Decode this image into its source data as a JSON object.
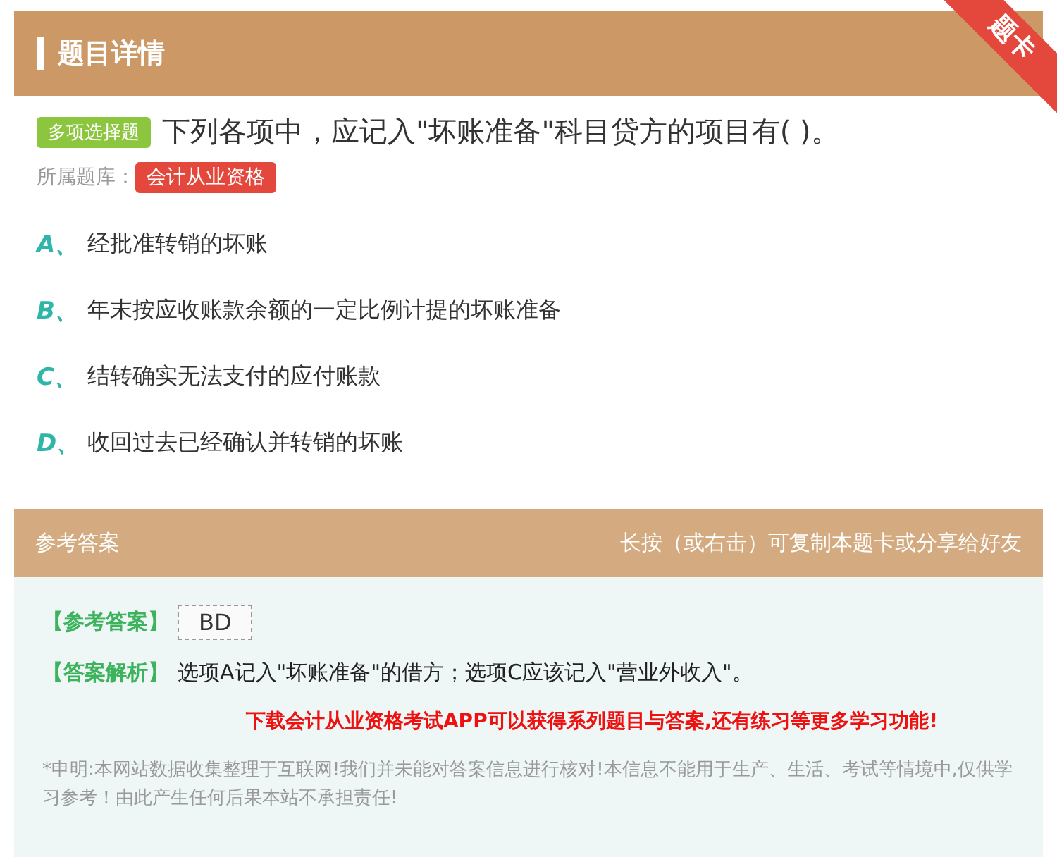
{
  "header": {
    "title": "题目详情",
    "ribbon": "题卡"
  },
  "question": {
    "type_badge": "多项选择题",
    "text": "下列各项中，应记入\"坏账准备\"科目贷方的项目有( )。",
    "bank_label": "所属题库：",
    "bank_tag": "会计从业资格"
  },
  "options": [
    {
      "letter": "A、",
      "text": "经批准转销的坏账"
    },
    {
      "letter": "B、",
      "text": "年末按应收账款余额的一定比例计提的坏账准备"
    },
    {
      "letter": "C、",
      "text": "结转确实无法支付的应付账款"
    },
    {
      "letter": "D、",
      "text": "收回过去已经确认并转销的坏账"
    }
  ],
  "answer_section": {
    "title": "参考答案",
    "hint": "长按（或右击）可复制本题卡或分享给好友",
    "answer_label": "【参考答案】",
    "answer": "BD",
    "analysis_label": "【答案解析】",
    "analysis": "选项A记入\"坏账准备\"的借方；选项C应该记入\"营业外收入\"。",
    "promo": "下载会计从业资格考试APP可以获得系列题目与答案,还有练习等更多学习功能!",
    "disclaimer": "*申明:本网站数据收集整理于互联网!我们并未能对答案信息进行核对!本信息不能用于生产、生活、考试等情境中,仅供学习参考！由此产生任何后果本站不承担责任!"
  }
}
